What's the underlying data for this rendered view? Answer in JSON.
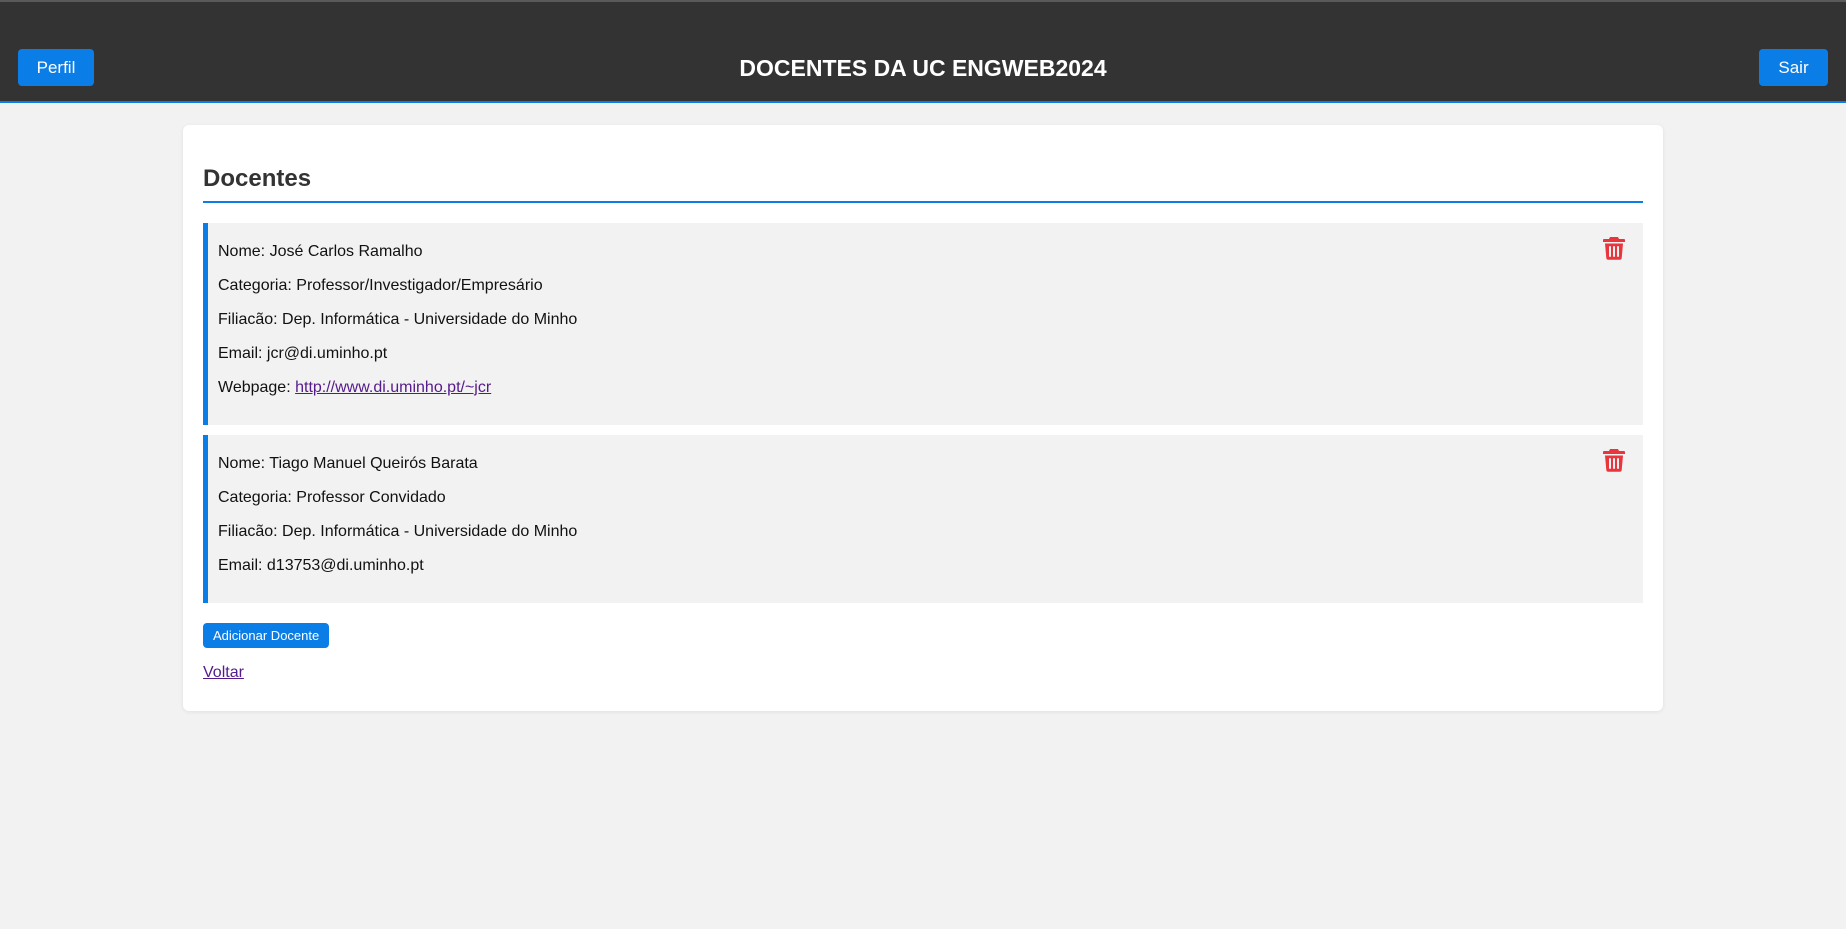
{
  "header": {
    "profile_label": "Perfil",
    "title": "DOCENTES DA UC ENGWEB2024",
    "logout_label": "Sair"
  },
  "main": {
    "heading": "Docentes",
    "docentes": [
      {
        "nome": "Nome: José Carlos Ramalho",
        "categoria": "Categoria: Professor/Investigador/Empresário",
        "filiacao": "Filiacão: Dep. Informática - Universidade do Minho",
        "email": "Email: jcr@di.uminho.pt",
        "webpage_label": "Webpage: ",
        "webpage_url": "http://www.di.uminho.pt/~jcr",
        "delete_icon": "trash-icon"
      },
      {
        "nome": "Nome: Tiago Manuel Queirós Barata",
        "categoria": "Categoria: Professor Convidado",
        "filiacao": "Filiacão: Dep. Informática - Universidade do Minho",
        "email": "Email: d13753@di.uminho.pt",
        "delete_icon": "trash-icon"
      }
    ],
    "add_label": "Adicionar Docente",
    "back_label": "Voltar"
  },
  "colors": {
    "header_bg": "#333333",
    "accent": "#0b7de6",
    "delete": "#e8363c",
    "link_visited": "#551a8b"
  }
}
